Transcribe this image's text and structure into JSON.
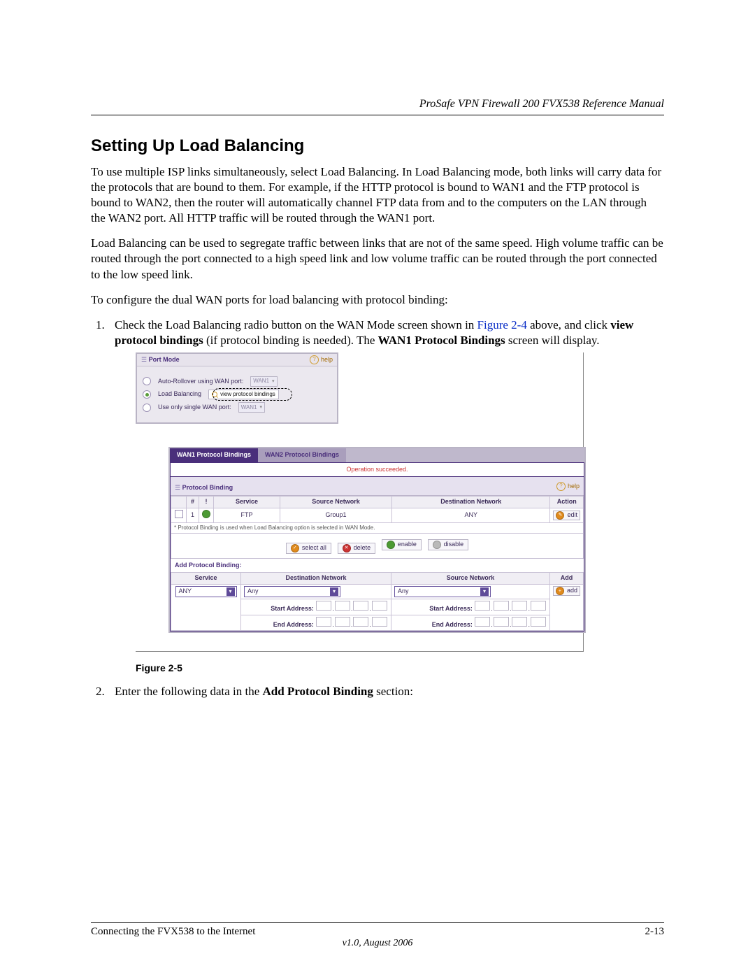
{
  "header": {
    "doc_title": "ProSafe VPN Firewall 200 FVX538 Reference Manual"
  },
  "section_title": "Setting Up Load Balancing",
  "para1": "To use multiple ISP links simultaneously, select Load Balancing. In Load Balancing mode, both links will carry data for the protocols that are bound to them. For example, if the HTTP protocol is bound to WAN1 and the FTP protocol is bound to WAN2, then the router will automatically channel FTP data from and to the computers on the LAN through the WAN2 port. All HTTP traffic will be routed through the WAN1 port.",
  "para2": "Load Balancing can be used to segregate traffic between links that are not of the same speed. High volume traffic can be routed through the port connected to a high speed link and low volume traffic can be routed through the port connected to the low speed link.",
  "para3": "To configure the dual WAN ports for load balancing with protocol binding:",
  "step1": {
    "pre": "Check the Load Balancing radio button on the WAN Mode screen shown in ",
    "figref": "Figure 2-4",
    "mid1": " above, and click ",
    "bold1": "view protocol bindings",
    "mid2": " (if protocol binding is needed). The ",
    "bold2": "WAN1 Protocol Bindings",
    "post": " screen will display."
  },
  "step2": {
    "pre": "Enter the following data in the ",
    "bold": "Add Protocol Binding",
    "post": " section:"
  },
  "figure_caption": "Figure 2-5",
  "footer": {
    "chapter": "Connecting the FVX538 to the Internet",
    "page": "2-13",
    "version": "v1.0, August 2006"
  },
  "ui": {
    "help": "help",
    "port_mode": {
      "title": "Port Mode",
      "opt_rollover": "Auto-Rollover using WAN port:",
      "opt_loadbal": "Load Balancing",
      "view_btn": "view protocol bindings",
      "opt_single": "Use only single WAN port:",
      "wan_sel": "WAN1"
    },
    "tabs": {
      "t1": "WAN1 Protocol Bindings",
      "t2": "WAN2 Protocol Bindings"
    },
    "status": "Operation succeeded.",
    "pb_title": "Protocol Binding",
    "cols": {
      "hash": "#",
      "bang": "!",
      "service": "Service",
      "src": "Source Network",
      "dst": "Destination Network",
      "action": "Action"
    },
    "row1": {
      "num": "1",
      "service": "FTP",
      "src": "Group1",
      "dst": "ANY",
      "action": "edit"
    },
    "footnote": "* Protocol Binding is used when Load Balancing option is selected in WAN Mode.",
    "buttons": {
      "selectall": "select all",
      "delete": "delete",
      "enable": "enable",
      "disable": "disable",
      "add": "add"
    },
    "add_title": "Add Protocol Binding:",
    "add_cols": {
      "service": "Service",
      "dst": "Destination Network",
      "src": "Source Network",
      "add": "Add"
    },
    "any": "Any",
    "anycaps": "ANY",
    "start": "Start Address:",
    "end": "End Address:"
  }
}
